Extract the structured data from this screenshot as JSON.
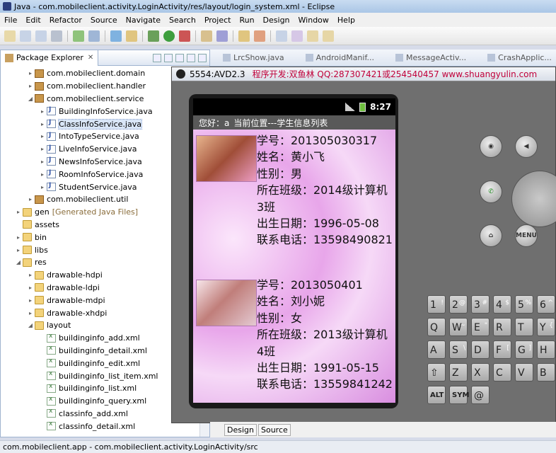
{
  "window": {
    "title": "Java - com.mobileclient.activity.LoginActivity/res/layout/login_system.xml - Eclipse"
  },
  "menu": [
    "File",
    "Edit",
    "Refactor",
    "Source",
    "Navigate",
    "Search",
    "Project",
    "Run",
    "Design",
    "Window",
    "Help"
  ],
  "package_explorer": {
    "tab_label": "Package Explorer",
    "close_glyph": "✕",
    "items": [
      {
        "depth": 2,
        "type": "pkg",
        "arrow": "▸",
        "label": "com.mobileclient.domain"
      },
      {
        "depth": 2,
        "type": "pkg",
        "arrow": "▸",
        "label": "com.mobileclient.handler"
      },
      {
        "depth": 2,
        "type": "pkg",
        "arrow": "◢",
        "label": "com.mobileclient.service"
      },
      {
        "depth": 3,
        "type": "java",
        "arrow": "▸",
        "label": "BuildingInfoService.java"
      },
      {
        "depth": 3,
        "type": "java",
        "arrow": "▸",
        "label": "ClassInfoService.java",
        "selected": true
      },
      {
        "depth": 3,
        "type": "java",
        "arrow": "▸",
        "label": "IntoTypeService.java"
      },
      {
        "depth": 3,
        "type": "java",
        "arrow": "▸",
        "label": "LiveInfoService.java"
      },
      {
        "depth": 3,
        "type": "java",
        "arrow": "▸",
        "label": "NewsInfoService.java"
      },
      {
        "depth": 3,
        "type": "java",
        "arrow": "▸",
        "label": "RoomInfoService.java"
      },
      {
        "depth": 3,
        "type": "java",
        "arrow": "▸",
        "label": "StudentService.java"
      },
      {
        "depth": 2,
        "type": "pkg",
        "arrow": "▸",
        "label": "com.mobileclient.util"
      },
      {
        "depth": 1,
        "type": "folder",
        "arrow": "▸",
        "label": "gen",
        "note": "[Generated Java Files]"
      },
      {
        "depth": 1,
        "type": "folder",
        "arrow": "",
        "label": "assets"
      },
      {
        "depth": 1,
        "type": "folder",
        "arrow": "▸",
        "label": "bin"
      },
      {
        "depth": 1,
        "type": "folder",
        "arrow": "▸",
        "label": "libs"
      },
      {
        "depth": 1,
        "type": "folder",
        "arrow": "◢",
        "label": "res"
      },
      {
        "depth": 2,
        "type": "folder",
        "arrow": "▸",
        "label": "drawable-hdpi"
      },
      {
        "depth": 2,
        "type": "folder",
        "arrow": "▸",
        "label": "drawable-ldpi"
      },
      {
        "depth": 2,
        "type": "folder",
        "arrow": "▸",
        "label": "drawable-mdpi"
      },
      {
        "depth": 2,
        "type": "folder",
        "arrow": "▸",
        "label": "drawable-xhdpi"
      },
      {
        "depth": 2,
        "type": "folder",
        "arrow": "◢",
        "label": "layout"
      },
      {
        "depth": 3,
        "type": "xml",
        "arrow": "",
        "label": "buildinginfo_add.xml"
      },
      {
        "depth": 3,
        "type": "xml",
        "arrow": "",
        "label": "buildinginfo_detail.xml"
      },
      {
        "depth": 3,
        "type": "xml",
        "arrow": "",
        "label": "buildinginfo_edit.xml"
      },
      {
        "depth": 3,
        "type": "xml",
        "arrow": "",
        "label": "buildinginfo_list_item.xml"
      },
      {
        "depth": 3,
        "type": "xml",
        "arrow": "",
        "label": "buildinginfo_list.xml"
      },
      {
        "depth": 3,
        "type": "xml",
        "arrow": "",
        "label": "buildinginfo_query.xml"
      },
      {
        "depth": 3,
        "type": "xml",
        "arrow": "",
        "label": "classinfo_add.xml"
      },
      {
        "depth": 3,
        "type": "xml",
        "arrow": "",
        "label": "classinfo_detail.xml"
      }
    ]
  },
  "editor_tabs": [
    "LrcShow.java",
    "AndroidManif...",
    "MessageActiv...",
    "CrashApplic..."
  ],
  "editor_bottom_tabs": [
    "Design",
    "Source"
  ],
  "statusbar": {
    "text": "com.mobileclient.app - com.mobileclient.activity.LoginActivity/src"
  },
  "emulator": {
    "device": "5554:AVD2.3",
    "promo": "程序开发:双鱼林 QQ:287307421或254540457 www.shuangyulin.com",
    "status_time": "8:27",
    "app_header": {
      "greeting": "您好：a",
      "location": "当前位置---学生信息列表"
    },
    "students": [
      {
        "lines": [
          "学号：2013050303​17",
          "姓名：黄小飞",
          "性别：男",
          "所在班级：2014级计算机3班",
          "出生日期：1996-05-08",
          "联系电话：13598490821"
        ]
      },
      {
        "lines": [
          "学号：2013050401",
          "姓名：刘小妮",
          "性别：女",
          "所在班级：2013级计算机4班",
          "出生日期：1991-05-15",
          "联系电话：13559841242"
        ]
      }
    ],
    "hw_buttons": {
      "menu": "MENU"
    },
    "keyboard": {
      "row1": [
        {
          "k": "1",
          "s": "!"
        },
        {
          "k": "2",
          "s": "@"
        },
        {
          "k": "3",
          "s": "#"
        },
        {
          "k": "4",
          "s": "$"
        },
        {
          "k": "5",
          "s": "%"
        },
        {
          "k": "6",
          "s": "^"
        }
      ],
      "row2": [
        {
          "k": "Q",
          "s": ""
        },
        {
          "k": "W",
          "s": "~"
        },
        {
          "k": "E",
          "s": "\""
        },
        {
          "k": "R",
          "s": ""
        },
        {
          "k": "T",
          "s": ""
        },
        {
          "k": "Y",
          "s": "{"
        }
      ],
      "row3": [
        {
          "k": "A",
          "s": ""
        },
        {
          "k": "S",
          "s": "\\"
        },
        {
          "k": "D",
          "s": ""
        },
        {
          "k": "F",
          "s": "["
        },
        {
          "k": "G",
          "s": "]"
        },
        {
          "k": "H",
          "s": ""
        }
      ],
      "row4": [
        {
          "k": "⇧",
          "s": ""
        },
        {
          "k": "Z",
          "s": ""
        },
        {
          "k": "X",
          "s": ""
        },
        {
          "k": "C",
          "s": ""
        },
        {
          "k": "V",
          "s": ""
        },
        {
          "k": "B",
          "s": ""
        }
      ],
      "row5": [
        {
          "k": "ALT",
          "s": ""
        },
        {
          "k": "SYM",
          "s": ""
        },
        {
          "k": "@",
          "s": ""
        }
      ]
    }
  }
}
